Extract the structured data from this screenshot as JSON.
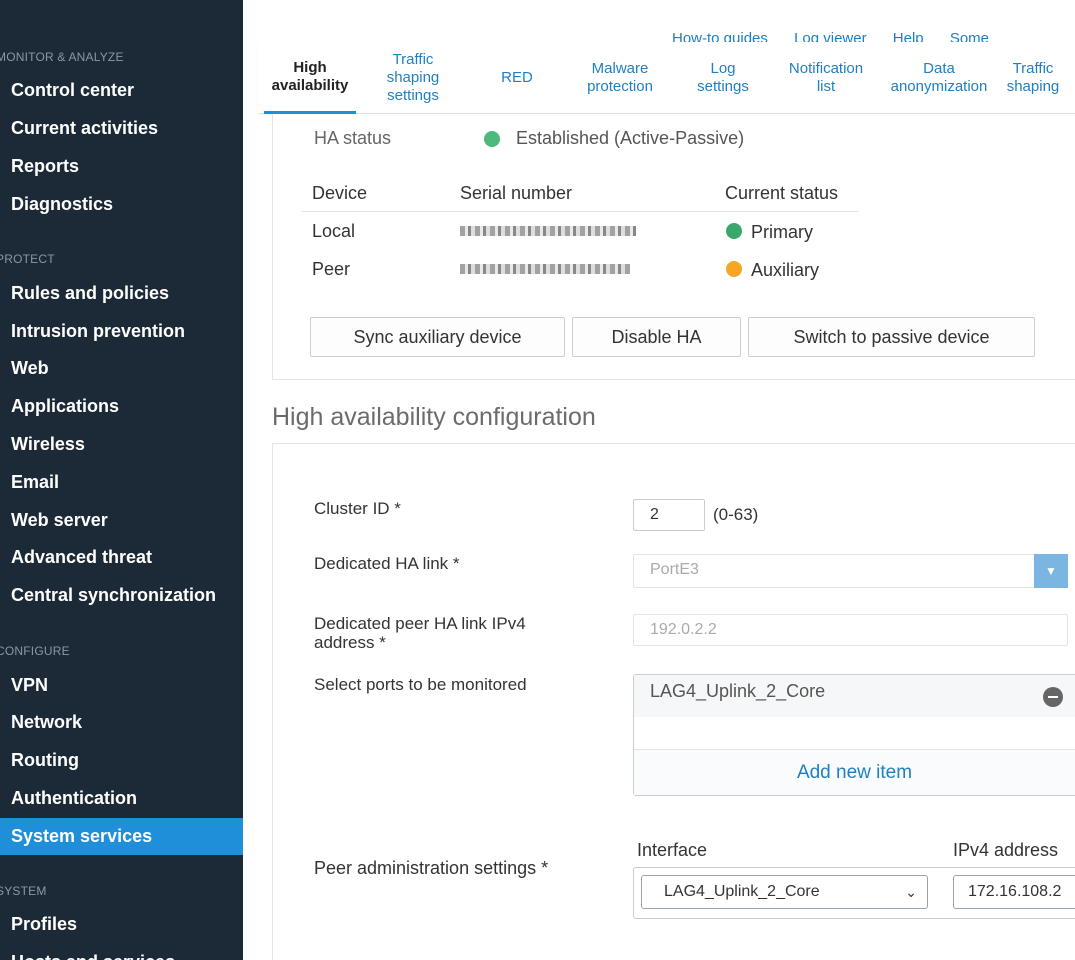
{
  "sidebar": {
    "sections": {
      "monitor": "MONITOR & ANALYZE",
      "protect": "PROTECT",
      "configure": "CONFIGURE",
      "system": "SYSTEM"
    },
    "items": {
      "control_center": "Control center",
      "current_activities": "Current activities",
      "reports": "Reports",
      "diagnostics": "Diagnostics",
      "rules": "Rules and policies",
      "intrusion": "Intrusion prevention",
      "web": "Web",
      "applications": "Applications",
      "wireless": "Wireless",
      "email": "Email",
      "web_server": "Web server",
      "advanced_threat": "Advanced threat",
      "central_sync": "Central synchronization",
      "vpn": "VPN",
      "network": "Network",
      "routing": "Routing",
      "authentication": "Authentication",
      "system_services": "System services",
      "profiles": "Profiles",
      "hosts_services": "Hosts and services"
    },
    "active_item": "System services"
  },
  "toplinks": {
    "guides": "How-to guides",
    "log_viewer": "Log viewer",
    "help": "Help",
    "user": "Some"
  },
  "tabs": {
    "high_availability": "High availability",
    "traffic_shaping_settings": "Traffic shaping settings",
    "red": "RED",
    "malware_protection": "Malware protection",
    "log_settings": "Log settings",
    "notification_list": "Notification list",
    "data_anonymization": "Data anonymization",
    "traffic_shaping": "Traffic shaping"
  },
  "status": {
    "ha_status_label": "HA status",
    "ha_status_value": "Established (Active-Passive)",
    "columns": {
      "device": "Device",
      "serial": "Serial number",
      "current_status": "Current status"
    },
    "rows": {
      "local": {
        "device": "Local",
        "status": "Primary"
      },
      "peer": {
        "device": "Peer",
        "status": "Auxiliary"
      }
    },
    "colors": {
      "established": "#4cba7a",
      "primary": "#3aa86a",
      "auxiliary": "#f5a623"
    },
    "buttons": {
      "sync": "Sync auxiliary device",
      "disable": "Disable HA",
      "switch": "Switch to passive device"
    }
  },
  "config": {
    "title": "High availability configuration",
    "cluster_id": {
      "label": "Cluster ID *",
      "value": "2",
      "range": "(0-63)"
    },
    "ha_link": {
      "label": "Dedicated HA link *",
      "value": "PortE3"
    },
    "peer_ip": {
      "label_line1": "Dedicated peer HA link IPv4",
      "label_line2": "address *",
      "value": "192.0.2.2"
    },
    "ports": {
      "label": "Select ports to be monitored",
      "item": "LAG4_Uplink_2_Core",
      "add": "Add new item"
    },
    "peer_admin": {
      "label": "Peer administration settings *",
      "interface_label": "Interface",
      "ipv4_label": "IPv4 address",
      "interface_value": "LAG4_Uplink_2_Core",
      "ipv4_value": "172.16.108.2"
    }
  },
  "accent": "#1e8fd8"
}
